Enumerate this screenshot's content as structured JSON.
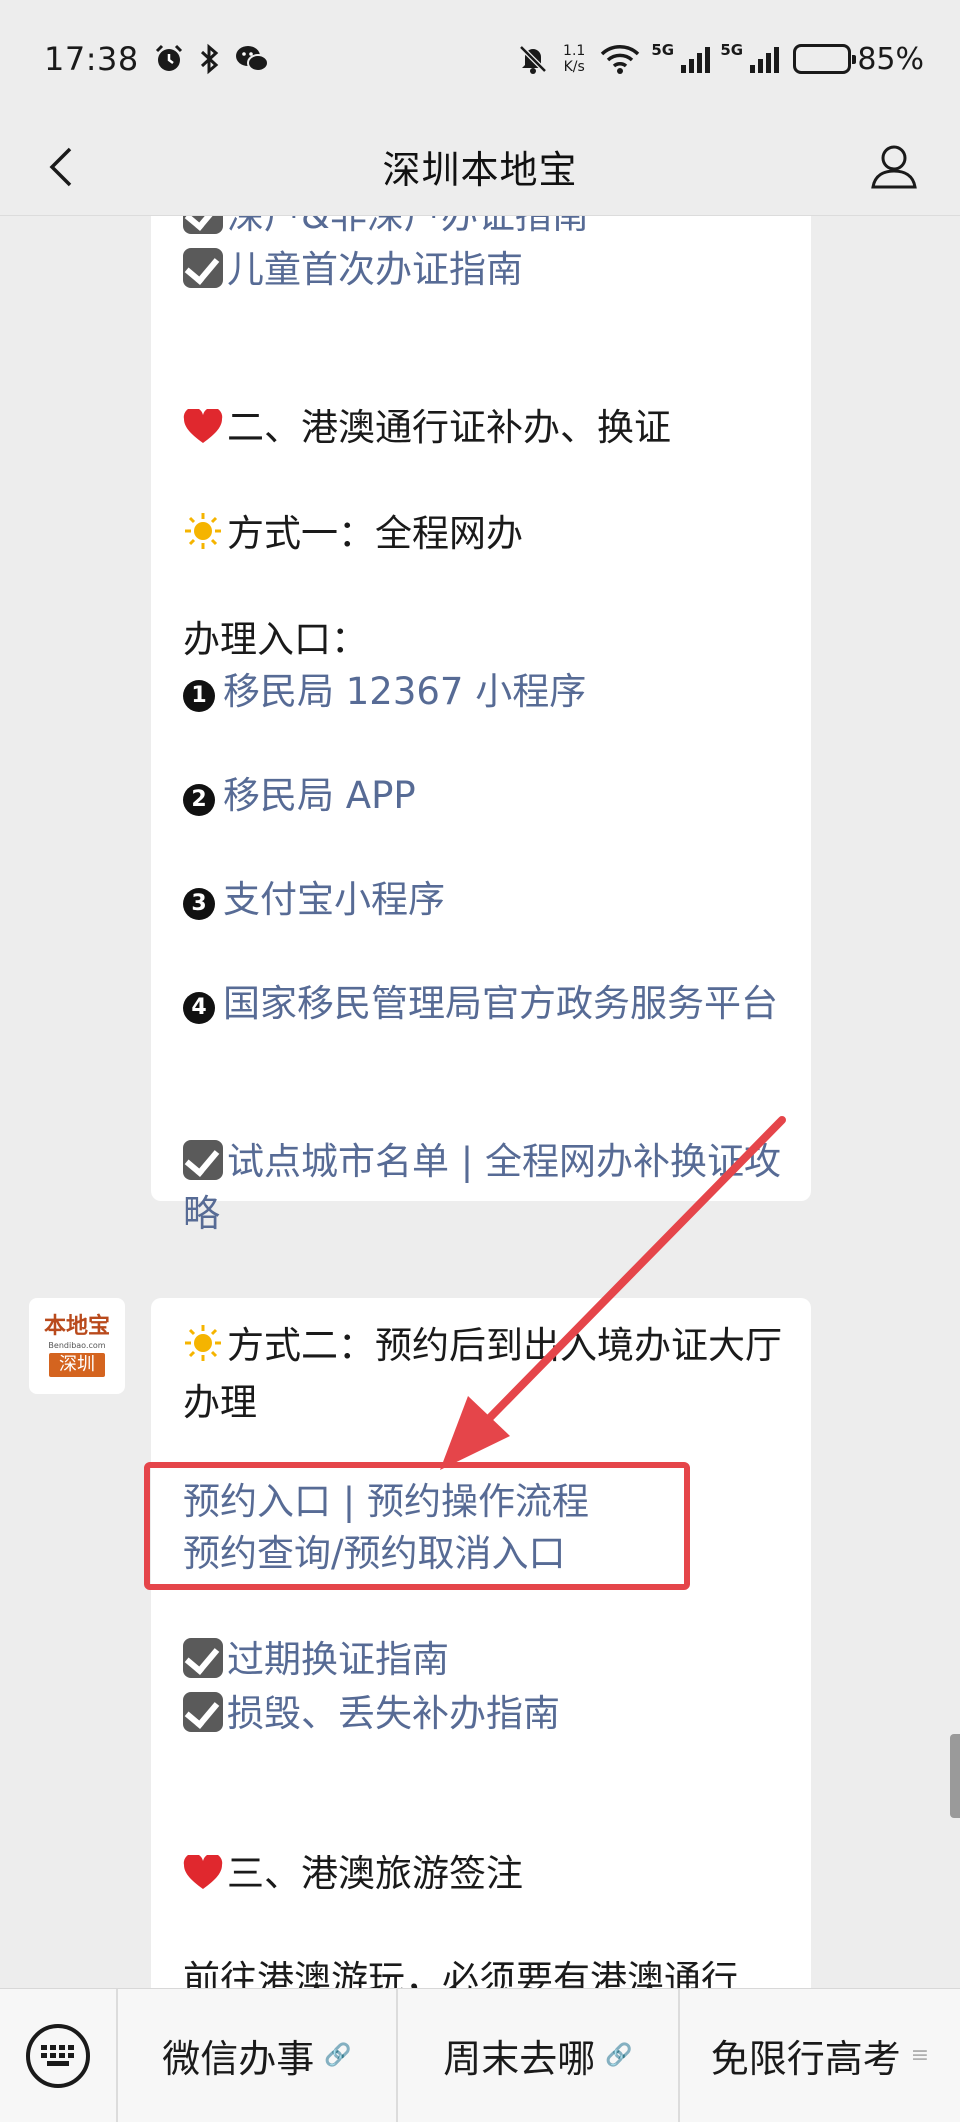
{
  "status_bar": {
    "time": "17:38",
    "net_speed_value": "1.1",
    "net_speed_unit": "K/s",
    "signal1_label": "5G",
    "signal2_label": "5G",
    "battery_percent": "85%",
    "battery_level": 0.85,
    "icons": [
      "alarm-icon",
      "bluetooth-icon",
      "wechat-icon",
      "mute-icon",
      "wifi-icon",
      "signal-icon",
      "battery-icon"
    ]
  },
  "nav": {
    "title": "深圳本地宝"
  },
  "message1": {
    "lines": [
      "深户&非深户办证指南",
      "儿童首次办证指南",
      "二、港澳通行证补办、换证",
      "方式一：全程网办",
      "办理入口：",
      "移民局 12367 小程序",
      "移民局 APP",
      "支付宝小程序",
      "国家移民管理局官方政务服务平台",
      "试点城市名单 | 全程网办补换证攻略"
    ],
    "numbers": [
      "1",
      "2",
      "3",
      "4"
    ]
  },
  "avatar": {
    "brand": "本地宝",
    "domain": "Bendibao.com",
    "city": "深圳"
  },
  "message2": {
    "lines": [
      "方式二：预约后到出入境办证大厅办理",
      "预约入口 | 预约操作流程",
      "预约查询/预约取消入口",
      "过期换证指南",
      "损毁、丢失补办指南",
      "三、港澳旅游签注",
      "前往港澳游玩，必须要有港澳通行"
    ]
  },
  "bottom_menu": {
    "items": [
      "微信办事",
      "周末去哪",
      "免限行高考"
    ]
  },
  "colors": {
    "link": "#576b95",
    "highlight": "#e5454a",
    "background": "#ededed"
  }
}
